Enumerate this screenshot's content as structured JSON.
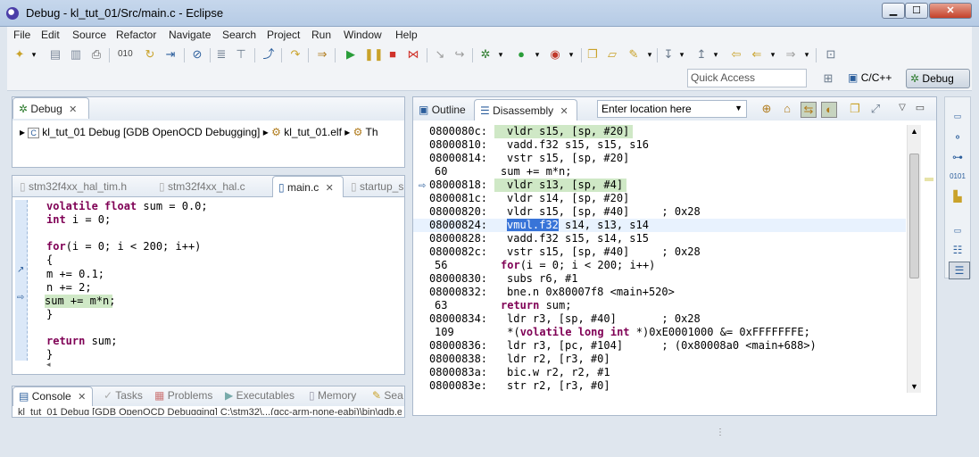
{
  "window": {
    "title": "Debug - kl_tut_01/Src/main.c - Eclipse",
    "min": "▁",
    "max": "☐",
    "close": "✕"
  },
  "menu": [
    "File",
    "Edit",
    "Source",
    "Refactor",
    "Navigate",
    "Search",
    "Project",
    "Run",
    "Window",
    "Help"
  ],
  "toolbar": {
    "quick_access_placeholder": "Quick Access",
    "perspectives": [
      {
        "label": "C/C++",
        "active": false
      },
      {
        "label": "Debug",
        "active": true
      }
    ]
  },
  "debug_view": {
    "tab": "Debug",
    "breadcrumb": [
      "kl_tut_01 Debug [GDB OpenOCD Debugging]",
      "kl_tut_01.elf",
      "Th"
    ]
  },
  "editor": {
    "tabs": [
      {
        "label": "stm32f4xx_hal_tim.h",
        "active": false
      },
      {
        "label": "stm32f4xx_hal.c",
        "active": false
      },
      {
        "label": "main.c",
        "active": true
      },
      {
        "label": "startup_s",
        "active": false
      }
    ],
    "lines": [
      {
        "text": "volatile float sum = 0.0;"
      },
      {
        "text": "int i = 0;"
      },
      {
        "text": ""
      },
      {
        "text": "for(i = 0; i < 200; i++)"
      },
      {
        "text": "{"
      },
      {
        "text": "m += 0.1;"
      },
      {
        "text": "n += 2;"
      },
      {
        "text": "sum += m*n;"
      },
      {
        "text": "}"
      },
      {
        "text": ""
      },
      {
        "text": "return sum;"
      },
      {
        "text": "}"
      }
    ]
  },
  "bottom": {
    "tabs": [
      "Console",
      "Tasks",
      "Problems",
      "Executables",
      "Memory",
      "Sea"
    ],
    "console_text": "kl_tut_01 Debug [GDB OpenOCD Debugging] C:\\stm32\\...(gcc-arm-none-eabi)\\bin\\gdb.exe"
  },
  "disasm": {
    "tabs": [
      {
        "label": "Outline",
        "active": false
      },
      {
        "label": "Disassembly",
        "active": true
      }
    ],
    "location_placeholder": "Enter location here",
    "rows": [
      {
        "addr": "0800080c:",
        "code": "vldr s15, [sp, #20]",
        "type": "asm"
      },
      {
        "addr": "08000810:",
        "code": "vadd.f32 s15, s15, s16",
        "type": "asm"
      },
      {
        "addr": "08000814:",
        "code": "vstr s15, [sp, #20]",
        "type": "asm"
      },
      {
        "addr": "60",
        "code": "sum += m*n;",
        "type": "src"
      },
      {
        "addr": "08000818:",
        "code": "vldr s13, [sp, #4]",
        "type": "asm"
      },
      {
        "addr": "0800081c:",
        "code": "vldr s14, [sp, #20]",
        "type": "asm"
      },
      {
        "addr": "08000820:",
        "code": "vldr s15, [sp, #40]     ; 0x28",
        "type": "asm"
      },
      {
        "addr": "08000824:",
        "code": "vmul.f32",
        "rest": " s14, s13, s14",
        "type": "asm"
      },
      {
        "addr": "08000828:",
        "code": "vadd.f32 s15, s14, s15",
        "type": "asm"
      },
      {
        "addr": "0800082c:",
        "code": "vstr s15, [sp, #40]     ; 0x28",
        "type": "asm"
      },
      {
        "addr": "56",
        "code": "for(i = 0; i < 200; i++)",
        "type": "src"
      },
      {
        "addr": "08000830:",
        "code": "subs r6, #1",
        "type": "asm"
      },
      {
        "addr": "08000832:",
        "code": "bne.n 0x80007f8 <main+520>",
        "type": "asm"
      },
      {
        "addr": "63",
        "code": "return sum;",
        "type": "src"
      },
      {
        "addr": "08000834:",
        "code": "ldr r3, [sp, #40]       ; 0x28",
        "type": "asm"
      },
      {
        "addr": "109",
        "code": " *(volatile long int *)0xE0001000 &= 0xFFFFFFFE;",
        "type": "src"
      },
      {
        "addr": "08000836:",
        "code": "ldr r3, [pc, #104]      ; (0x80008a0 <main+688>)",
        "type": "asm"
      },
      {
        "addr": "08000838:",
        "code": "ldr r2, [r3, #0]",
        "type": "asm"
      },
      {
        "addr": "0800083a:",
        "code": "bic.w r2, r2, #1",
        "type": "asm"
      },
      {
        "addr": "0800083e:",
        "code": "str r2, [r3, #0]",
        "type": "asm"
      }
    ]
  },
  "colors": {
    "keyword": "#7f0055",
    "highlight": "#cfe8c6",
    "selection": "#3874d8",
    "address": "#1a1a1a"
  }
}
